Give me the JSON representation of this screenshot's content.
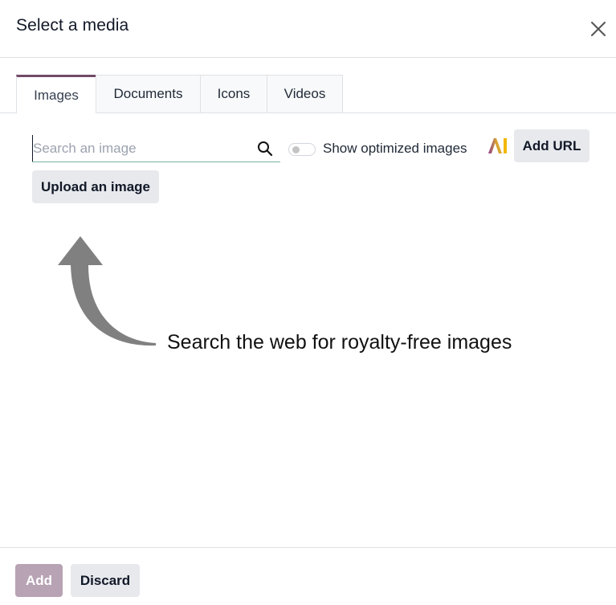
{
  "dialog": {
    "title": "Select a media"
  },
  "tabs": [
    {
      "label": "Images",
      "active": true
    },
    {
      "label": "Documents",
      "active": false
    },
    {
      "label": "Icons",
      "active": false
    },
    {
      "label": "Videos",
      "active": false
    }
  ],
  "search": {
    "placeholder": "Search an image",
    "value": ""
  },
  "toggle": {
    "label": "Show optimized images",
    "checked": false
  },
  "buttons": {
    "add_url": "Add URL",
    "upload": "Upload an image",
    "add": "Add",
    "discard": "Discard"
  },
  "hint": {
    "text": "Search the web for royalty-free images"
  },
  "icons": {
    "close": "close-icon",
    "search": "search-icon",
    "ai": "ai-icon",
    "arrow": "curved-arrow-icon"
  },
  "colors": {
    "brand": "#714b67",
    "add_button_disabled": "#b7a3b3",
    "secondary_button": "#e7e9ed",
    "search_underline": "#7fb3a6"
  }
}
